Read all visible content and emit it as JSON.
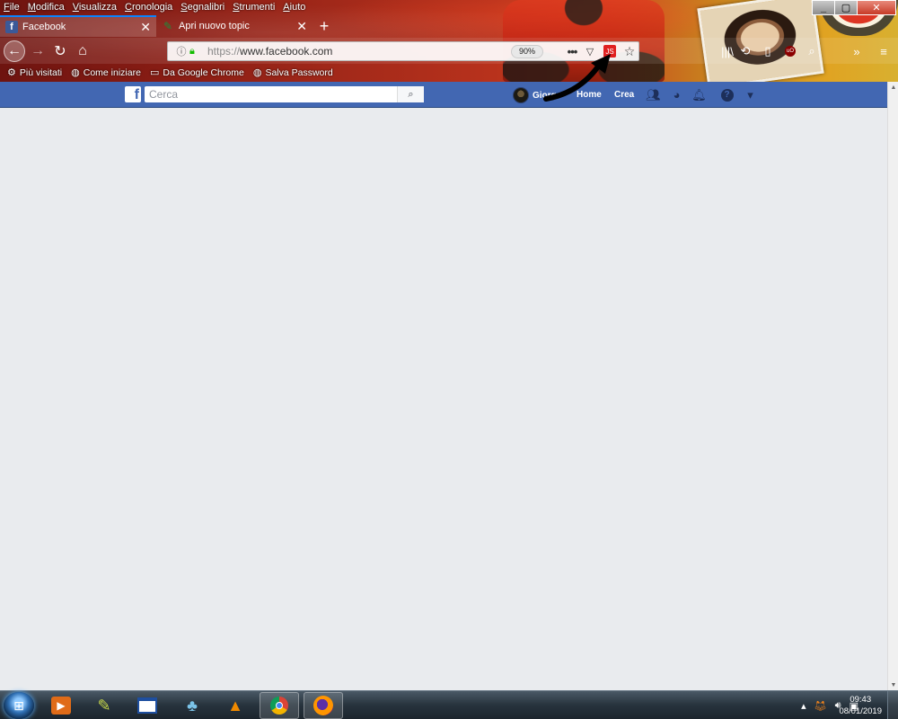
{
  "browser": {
    "menu": [
      "File",
      "Modifica",
      "Visualizza",
      "Cronologia",
      "Segnalibri",
      "Strumenti",
      "Aiuto"
    ],
    "tabs": [
      {
        "label": "Facebook",
        "active": true
      },
      {
        "label": "Apri nuovo topic",
        "active": false
      }
    ],
    "url": {
      "scheme": "https://",
      "host": "www.facebook.com",
      "zoom": "90%",
      "js_badge": "JS"
    },
    "bookmarks": [
      "Più visitati",
      "Come iniziare",
      "Da Google Chrome",
      "Salva Password"
    ],
    "icons": {
      "back": "back-arrow-icon",
      "forward": "forward-arrow-icon",
      "reload": "reload-icon",
      "home": "home-icon",
      "info": "info-icon",
      "lock": "lock-icon",
      "page_actions": "ellipsis-icon",
      "pocket": "pocket-icon",
      "star": "star-icon",
      "library": "library-icon",
      "sync": "sync-icon",
      "sidebar": "sidebar-icon",
      "ublock": "ublock-icon",
      "search": "search-icon",
      "overflow": "overflow-icon",
      "menu": "hamburger-icon"
    }
  },
  "facebook": {
    "search_placeholder": "Cerca",
    "profile_name": "Giorg",
    "nav": {
      "home": "Home",
      "create": "Crea"
    },
    "brand_color": "#4267b2",
    "icons": [
      "friends-icon",
      "messenger-icon",
      "notifications-icon",
      "help-icon",
      "dropdown-icon"
    ]
  },
  "taskbar": {
    "pinned": [
      "media-player-icon",
      "paint-icon",
      "window-icon",
      "network-icon",
      "vlc-icon",
      "chrome-icon",
      "firefox-icon"
    ],
    "clock_time": "09:43",
    "clock_date": "08/01/2019"
  }
}
